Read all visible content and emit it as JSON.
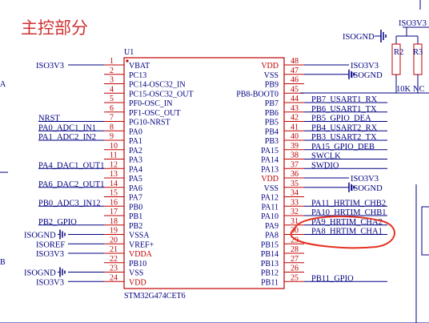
{
  "title": "主控部分",
  "chip": {
    "ref": "U1",
    "part": "STM32G474CET6"
  },
  "colors": {
    "wire": "#000080",
    "red": "#c00000",
    "highlight": "#e53020",
    "title": "#d03030"
  },
  "frame": {
    "row_a": "A",
    "row_b": "B"
  },
  "left_pins": [
    {
      "num": "1",
      "name": "VBAT",
      "net": "ISO3V3",
      "power": false
    },
    {
      "num": "2",
      "name": "PC13",
      "net": "",
      "power": false
    },
    {
      "num": "3",
      "name": "PC14-OSC32_IN",
      "net": "",
      "power": false
    },
    {
      "num": "4",
      "name": "PC15-OSC32_OUT",
      "net": "",
      "power": false
    },
    {
      "num": "5",
      "name": "PF0-OSC_IN",
      "net": "",
      "power": false
    },
    {
      "num": "6",
      "name": "PF1-OSC_OUT",
      "net": "",
      "power": false
    },
    {
      "num": "7",
      "name": "PG10-NRST",
      "net": "NRST",
      "power": false
    },
    {
      "num": "8",
      "name": "PA0",
      "net": "PA0_ADC1_IN1",
      "power": false
    },
    {
      "num": "9",
      "name": "PA1",
      "net": "PA1_ADC2_IN2",
      "power": false
    },
    {
      "num": "10",
      "name": "PA2",
      "net": "",
      "power": false
    },
    {
      "num": "11",
      "name": "PA3",
      "net": "",
      "power": false
    },
    {
      "num": "12",
      "name": "PA4",
      "net": "PA4_DAC1_OUT1",
      "power": false
    },
    {
      "num": "13",
      "name": "PA5",
      "net": "",
      "power": false
    },
    {
      "num": "14",
      "name": "PA6",
      "net": "PA6_DAC2_OUT1",
      "power": false
    },
    {
      "num": "15",
      "name": "PA7",
      "net": "",
      "power": false
    },
    {
      "num": "16",
      "name": "PB0",
      "net": "PB0_ADC3_IN12",
      "power": false
    },
    {
      "num": "17",
      "name": "PB1",
      "net": "",
      "power": false
    },
    {
      "num": "18",
      "name": "PB2",
      "net": "PB2_GPIO",
      "power": false
    },
    {
      "num": "19",
      "name": "VSSA",
      "net": "ISOGND",
      "power": false
    },
    {
      "num": "20",
      "name": "VREF+",
      "net": "ISOREF",
      "power": false
    },
    {
      "num": "21",
      "name": "VDDA",
      "net": "ISO3V3",
      "power": true
    },
    {
      "num": "22",
      "name": "PB10",
      "net": "",
      "power": false
    },
    {
      "num": "23",
      "name": "VSS",
      "net": "ISOGND",
      "power": false
    },
    {
      "num": "24",
      "name": "VDD",
      "net": "ISO3V3",
      "power": true
    }
  ],
  "right_pins": [
    {
      "num": "48",
      "name": "VDD",
      "net": "ISO3V3",
      "power": true
    },
    {
      "num": "47",
      "name": "VSS",
      "net": "ISOGND",
      "power": false
    },
    {
      "num": "46",
      "name": "PB9",
      "net": "",
      "power": false
    },
    {
      "num": "45",
      "name": "PB8-BOOT0",
      "net": "",
      "power": false
    },
    {
      "num": "44",
      "name": "PB7",
      "net": "PB7_USART1_RX",
      "power": false
    },
    {
      "num": "43",
      "name": "PB6",
      "net": "PB6_USART1_TX",
      "power": false
    },
    {
      "num": "42",
      "name": "PB5",
      "net": "PB5_GPIO_DEA",
      "power": false
    },
    {
      "num": "41",
      "name": "PB4",
      "net": "PB4_USART2_RX",
      "power": false
    },
    {
      "num": "40",
      "name": "PB3",
      "net": "PB3_USART2_TX",
      "power": false
    },
    {
      "num": "39",
      "name": "PA15",
      "net": "PA15_GPIO_DEB",
      "power": false
    },
    {
      "num": "38",
      "name": "PA14",
      "net": "SWCLK",
      "power": false
    },
    {
      "num": "37",
      "name": "PA13",
      "net": "SWDIO",
      "power": false
    },
    {
      "num": "36",
      "name": "VDD",
      "net": "ISO3V3",
      "power": true
    },
    {
      "num": "35",
      "name": "VSS",
      "net": "ISOGND",
      "power": false
    },
    {
      "num": "34",
      "name": "PA12",
      "net": "",
      "power": false
    },
    {
      "num": "33",
      "name": "PA11",
      "net": "PA11_HRTIM_CHB2",
      "power": false
    },
    {
      "num": "32",
      "name": "PA10",
      "net": "PA10_HRTIM_CHB1",
      "power": false
    },
    {
      "num": "31",
      "name": "PA9",
      "net": "PA9_HRTIM_CHA2",
      "power": false
    },
    {
      "num": "30",
      "name": "PA8",
      "net": "PA8_HRTIM_CHA1",
      "power": false
    },
    {
      "num": "29",
      "name": "PB15",
      "net": "",
      "power": false
    },
    {
      "num": "28",
      "name": "PB14",
      "net": "",
      "power": false
    },
    {
      "num": "27",
      "name": "PB13",
      "net": "",
      "power": false
    },
    {
      "num": "26",
      "name": "PB12",
      "net": "",
      "power": false
    },
    {
      "num": "25",
      "name": "PB11",
      "net": "PB11_GPIO",
      "power": false
    }
  ],
  "boot_circuit": {
    "supply": "ISO3V3",
    "ground": "ISOGND",
    "r2": {
      "ref": "R2",
      "value": "10K"
    },
    "r3": {
      "ref": "R3",
      "value": "NC"
    }
  }
}
